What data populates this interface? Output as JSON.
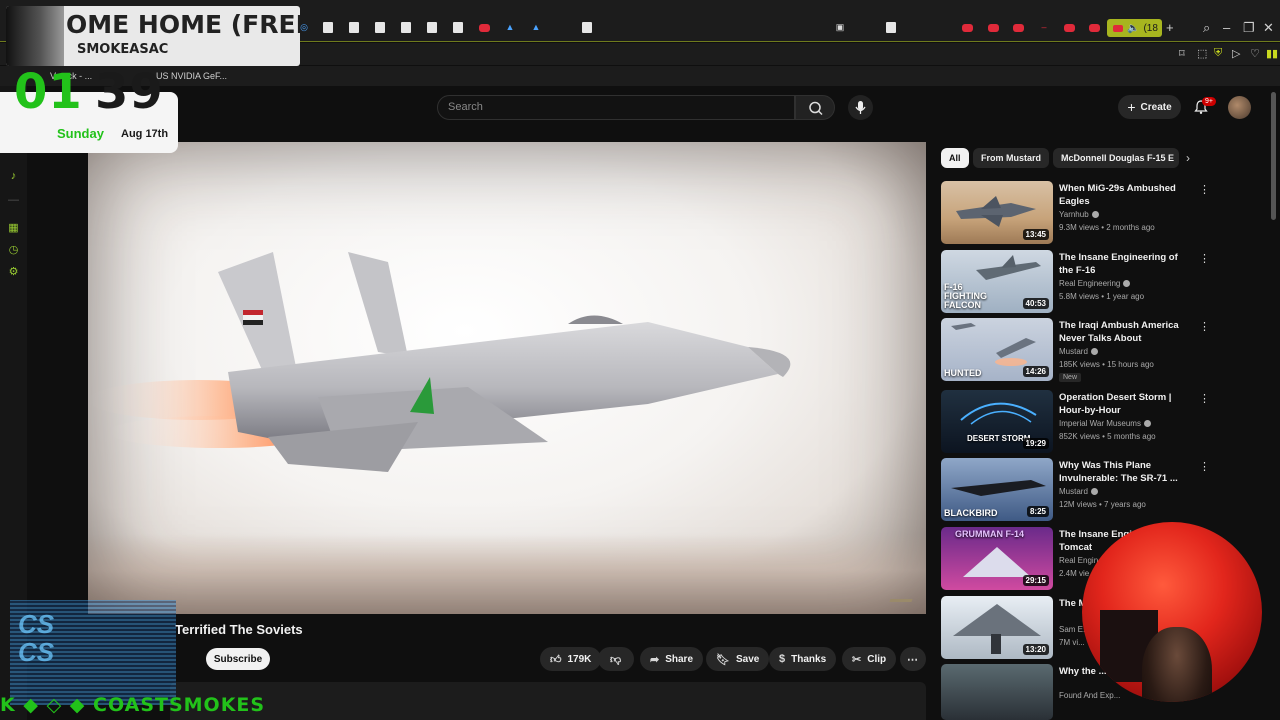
{
  "browser": {
    "active_tab_count": "(18",
    "new_tab": "+",
    "bookmarks": [
      "V...ack - ...",
      "US NVIDIA GeF..."
    ]
  },
  "youtube": {
    "search": {
      "placeholder": "Search"
    },
    "create_label": "Create",
    "notification_count": "9+"
  },
  "video": {
    "title_visible": "Terrified The Soviets",
    "subscribe_label": "Subscribe",
    "likes": "179K",
    "share_label": "Share",
    "save_label": "Save",
    "thanks_label": "Thanks",
    "clip_label": "Clip"
  },
  "chips": [
    "All",
    "From Mustard",
    "McDonnell Douglas F-15 E"
  ],
  "recommendations": [
    {
      "title": "When MiG-29s Ambushed Eagles",
      "channel": "Yarnhub",
      "meta": "9.3M views • 2 months ago",
      "duration": "13:45",
      "overlay": ""
    },
    {
      "title": "The Insane Engineering of the F-16",
      "channel": "Real Engineering",
      "meta": "5.8M views • 1 year ago",
      "duration": "40:53",
      "overlay": "F-16 FIGHTING FALCON"
    },
    {
      "title": "The Iraqi Ambush America Never Talks About",
      "channel": "Mustard",
      "meta": "185K views • 15 hours ago",
      "duration": "14:26",
      "overlay": "HUNTED",
      "badge": "New"
    },
    {
      "title": "Operation Desert Storm | Hour-by-Hour",
      "channel": "Imperial War Museums",
      "meta": "852K views • 5 months ago",
      "duration": "19:29",
      "overlay": "DESERT STORM"
    },
    {
      "title": "Why Was This Plane Invulnerable: The SR-71 ...",
      "channel": "Mustard",
      "meta": "12M views • 7 years ago",
      "duration": "8:25",
      "overlay": "BLACKBIRD"
    },
    {
      "title": "The Insane Engine... F-14 Tomcat",
      "channel": "Real Engin...",
      "meta": "2.4M vie...",
      "duration": "29:15",
      "overlay": "GRUMMAN F-14"
    },
    {
      "title": "The M... Ever",
      "channel": "Sam E...",
      "meta": "7M vi...",
      "duration": "13:20",
      "overlay": ""
    },
    {
      "title": "Why the ... 16 failed",
      "channel": "Found And Exp...",
      "meta": "",
      "duration": "",
      "overlay": ""
    }
  ],
  "overlay": {
    "now_playing_title": "OME HOME (FREE",
    "now_playing_artist": "SMOKEASAC",
    "clock_hour": "01",
    "clock_minute": "39",
    "day": "Sunday",
    "date": "Aug 17th",
    "handle": "COASTSMOKES"
  },
  "colors": {
    "accent_green": "#22c21a",
    "tab_highlight": "#a7b51f",
    "youtube_red": "#e02a3a"
  }
}
